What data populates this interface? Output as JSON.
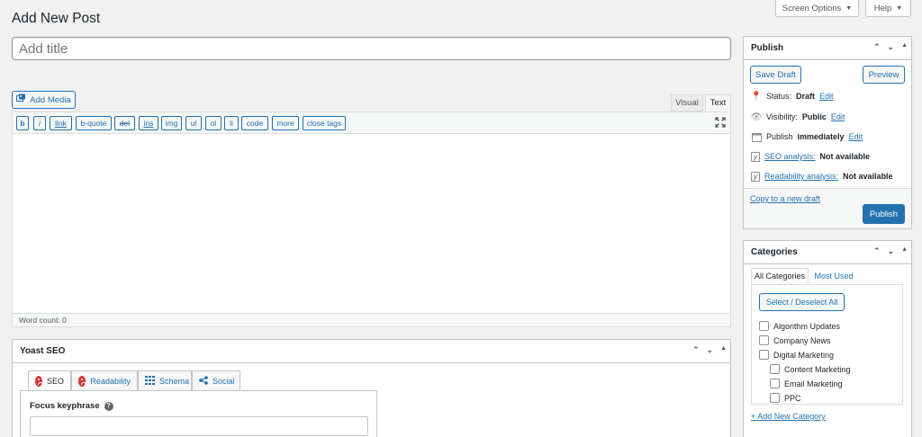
{
  "header": {
    "page_title": "Add New Post",
    "screen_options_label": "Screen Options",
    "help_label": "Help"
  },
  "title_field": {
    "placeholder": "Add title"
  },
  "editor": {
    "add_media_label": "Add Media",
    "tab_visual": "Visual",
    "tab_text": "Text",
    "quicktags": [
      "b",
      "i",
      "link",
      "b-quote",
      "del",
      "ins",
      "img",
      "ul",
      "ol",
      "li",
      "code",
      "more",
      "close tags"
    ],
    "word_count": "Word count: 0"
  },
  "publish_box": {
    "title": "Publish",
    "save_draft_label": "Save Draft",
    "preview_label": "Preview",
    "status_label": "Status:",
    "status_value": "Draft",
    "visibility_label": "Visibility:",
    "visibility_value": "Public",
    "publish_label": "Publish",
    "publish_value": "immediately",
    "edit_label": "Edit",
    "seo_link": "SEO analysis:",
    "seo_value": "Not available",
    "readability_link": "Readability analysis:",
    "readability_value": "Not available",
    "copy_draft_link": "Copy to a new draft",
    "publish_button": "Publish"
  },
  "categories_box": {
    "title": "Categories",
    "tab_all": "All Categories",
    "tab_most_used": "Most Used",
    "select_all_label": "Select / Deselect All",
    "items": [
      {
        "label": "Algorithm Updates",
        "checked": false,
        "level": 0
      },
      {
        "label": "Company News",
        "checked": false,
        "level": 0
      },
      {
        "label": "Digital Marketing",
        "checked": false,
        "level": 0
      },
      {
        "label": "Content Marketing",
        "checked": false,
        "level": 1
      },
      {
        "label": "Email Marketing",
        "checked": false,
        "level": 1
      },
      {
        "label": "PPC",
        "checked": false,
        "level": 1
      }
    ],
    "add_new_label": "+ Add New Category"
  },
  "yoast": {
    "title": "Yoast SEO",
    "tabs": [
      "SEO",
      "Readability",
      "Schema",
      "Social"
    ],
    "focus_keyphrase_label": "Focus keyphrase",
    "focus_keyphrase_value": ""
  },
  "colors": {
    "accent": "#2271b1",
    "error": "#dc3232",
    "background": "#f1f1f1"
  }
}
